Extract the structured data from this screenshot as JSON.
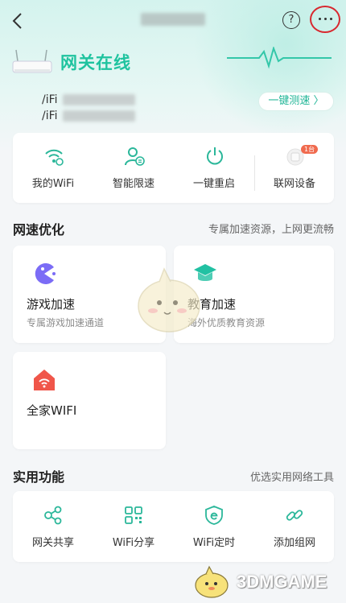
{
  "header": {
    "help_icon_text": "?",
    "status_text": "网关在线"
  },
  "wifi": {
    "lines": [
      "/iFi",
      "/iFi"
    ],
    "speedtest_label": "一键测速 〉"
  },
  "quick_actions": [
    {
      "label": "我的WiFi",
      "icon": "wifi-icon"
    },
    {
      "label": "智能限速",
      "icon": "user-speed-icon"
    },
    {
      "label": "一键重启",
      "icon": "power-icon"
    },
    {
      "label": "联网设备",
      "icon": "device-icon",
      "badge": "1台"
    }
  ],
  "speed_section": {
    "title": "网速优化",
    "subtitle": "专属加速资源，上网更流畅",
    "cards": [
      {
        "name": "游戏加速",
        "desc": "专属游戏加速通道",
        "icon": "game-icon"
      },
      {
        "name": "教育加速",
        "desc": "海外优质教育资源",
        "icon": "graduation-cap-icon"
      },
      {
        "name": "全家WIFI",
        "desc": "",
        "icon": "home-wifi-icon"
      }
    ]
  },
  "tools_section": {
    "title": "实用功能",
    "subtitle": "优选实用网络工具",
    "items": [
      {
        "label": "网关共享",
        "icon": "share-icon"
      },
      {
        "label": "WiFi分享",
        "icon": "qr-code-icon"
      },
      {
        "label": "WiFi定时",
        "icon": "timer-shield-icon"
      },
      {
        "label": "添加组网",
        "icon": "link-icon"
      }
    ]
  },
  "watermark": {
    "text": "3DMGAME"
  },
  "colors": {
    "accent": "#1fc39f",
    "icon_teal": "#2bb79a",
    "highlight_circle": "#d8282f",
    "game_purple": "#7b6cf6",
    "edu_teal": "#22c1a3",
    "home_red": "#f0564a"
  }
}
